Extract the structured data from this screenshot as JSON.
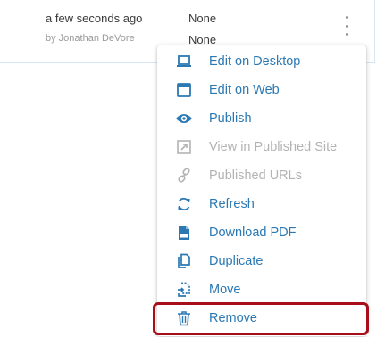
{
  "row": {
    "modified": "a few seconds ago",
    "modified_by": "by Jonathan DeVore",
    "status_line1": "None",
    "status_line2": "None"
  },
  "menu": {
    "items": [
      {
        "label": "Edit on Desktop",
        "icon": "laptop-icon",
        "enabled": true
      },
      {
        "label": "Edit on Web",
        "icon": "browser-window-icon",
        "enabled": true
      },
      {
        "label": "Publish",
        "icon": "eye-icon",
        "enabled": true
      },
      {
        "label": "View in Published Site",
        "icon": "external-link-icon",
        "enabled": false
      },
      {
        "label": "Published URLs",
        "icon": "link-icon",
        "enabled": false
      },
      {
        "label": "Refresh",
        "icon": "refresh-icon",
        "enabled": true
      },
      {
        "label": "Download PDF",
        "icon": "pdf-file-icon",
        "enabled": true
      },
      {
        "label": "Duplicate",
        "icon": "duplicate-icon",
        "enabled": true
      },
      {
        "label": "Move",
        "icon": "move-icon",
        "enabled": true
      },
      {
        "label": "Remove",
        "icon": "trash-icon",
        "enabled": true
      }
    ]
  },
  "colors": {
    "accent": "#2b78b3",
    "disabled": "#b3b3b3",
    "highlight_border": "#a80e1a"
  }
}
